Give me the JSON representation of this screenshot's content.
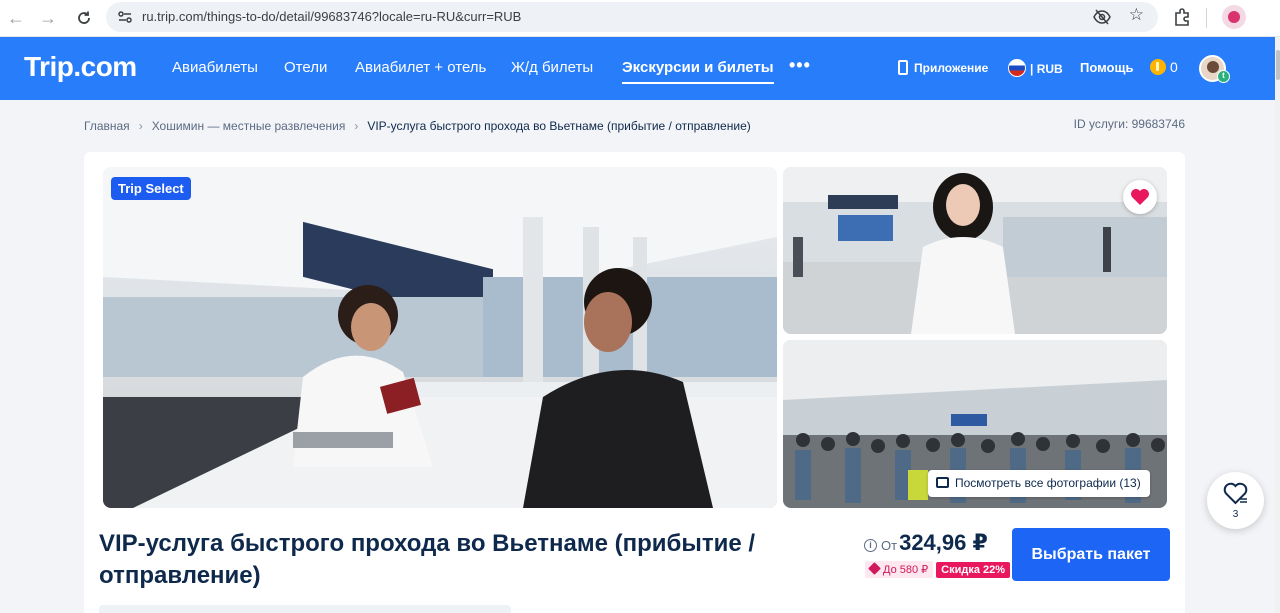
{
  "browser": {
    "url": "ru.trip.com/things-to-do/detail/99683746?locale=ru-RU&curr=RUB"
  },
  "header": {
    "logo": "Trip.com",
    "nav": [
      {
        "label": "Авиабилеты"
      },
      {
        "label": "Отели"
      },
      {
        "label": "Авиабилет + отель"
      },
      {
        "label": "Ж/д билеты"
      },
      {
        "label": "Экскурсии и билеты",
        "active": true
      }
    ],
    "more": "•••",
    "app_label": "Приложение",
    "currency_label": "| RUB",
    "help_label": "Помощь",
    "coins_count": "0",
    "brand_color": "#287dfa"
  },
  "breadcrumb": {
    "items": [
      "Главная",
      "Хошимин — местные развлечения",
      "VIP-услуга быстрого прохода во Вьетнаме (прибытие / отправление)"
    ],
    "service_id": "ID услуги: 99683746"
  },
  "gallery": {
    "badge": "Trip Select",
    "view_all": "Посмотреть все фотографии (13)"
  },
  "product": {
    "title": "VIP-услуга быстрого прохода во Вьетнаме (прибытие / отправление)",
    "price_prefix": "От",
    "price": "324,96 ₽",
    "coupon": "До 580 ₽",
    "discount": "Скидка 22%",
    "select_button": "Выбрать пакет"
  },
  "float_favorite": {
    "count": "3"
  }
}
